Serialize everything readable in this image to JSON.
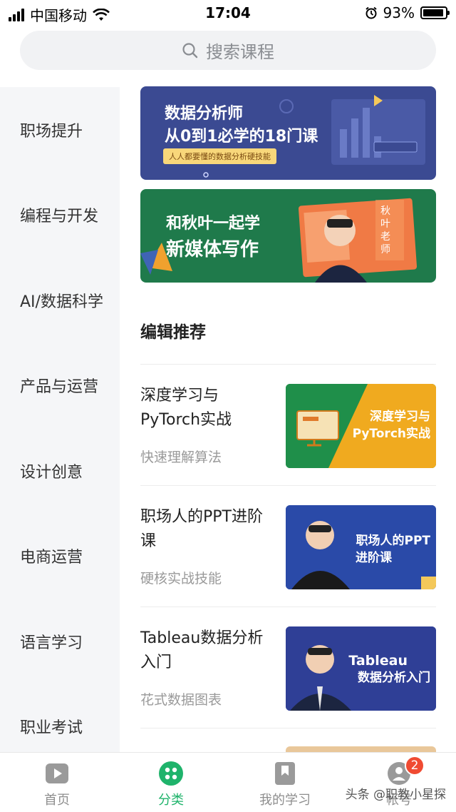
{
  "status": {
    "carrier": "中国移动",
    "time": "17:04",
    "battery": "93%",
    "battery_level": 0.93
  },
  "search": {
    "placeholder": "搜索课程"
  },
  "sidebar": {
    "items": [
      {
        "label": "职场提升"
      },
      {
        "label": "编程与开发"
      },
      {
        "label": "AI/数据科学"
      },
      {
        "label": "产品与运营"
      },
      {
        "label": "设计创意"
      },
      {
        "label": "电商运营"
      },
      {
        "label": "语言学习"
      },
      {
        "label": "职业考试"
      }
    ]
  },
  "banners": [
    {
      "title_line1": "数据分析师",
      "title_line2": "从0到1必学的18门课",
      "tag": "人人都要懂的数据分析硬技能"
    },
    {
      "title_line1": "和秋叶一起学",
      "title_line2": "新媒体写作",
      "side_text": "秋叶老师"
    }
  ],
  "section": {
    "title": "编辑推荐"
  },
  "courses": [
    {
      "name": "深度学习与PyTorch实战",
      "subtitle": "快速理解算法",
      "thumb_line1": "深度学习与",
      "thumb_line2": "PyTorch实战"
    },
    {
      "name": "职场人的PPT进阶课",
      "subtitle": "硬核实战技能",
      "thumb_line1": "职场人的PPT",
      "thumb_line2": "进阶课"
    },
    {
      "name": "Tableau数据分析入门",
      "subtitle": "花式数据图表",
      "thumb_line1": "Tableau",
      "thumb_line2": "数据分析入门"
    }
  ],
  "tabbar": {
    "items": [
      {
        "label": "首页",
        "icon": "play-icon"
      },
      {
        "label": "分类",
        "icon": "grid-icon"
      },
      {
        "label": "我的学习",
        "icon": "bookmark-icon"
      },
      {
        "label": "帐号",
        "icon": "user-icon"
      }
    ],
    "badge": "2"
  },
  "watermark": "头条 @职教小星探",
  "colors": {
    "accent": "#1fb36b",
    "badge": "#f04b32"
  }
}
